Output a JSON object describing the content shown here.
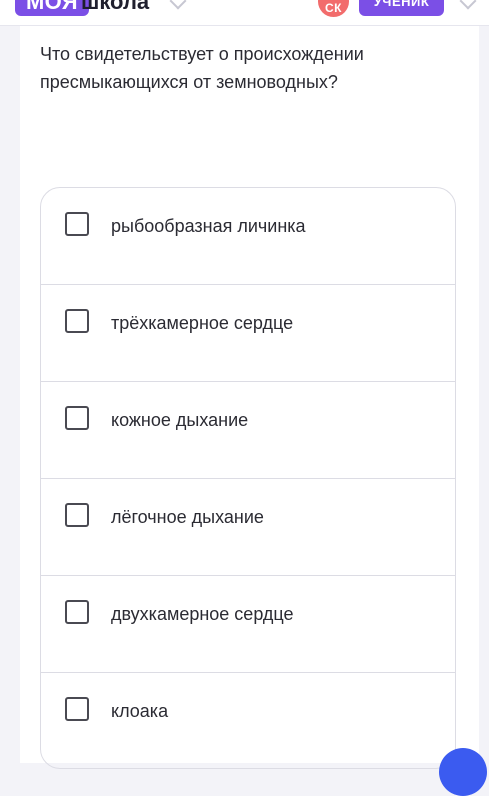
{
  "header": {
    "logo_badge": "МОЯ",
    "logo_text": "школа",
    "avatar_initials": "СК",
    "role_label": "УЧЕНИК"
  },
  "quiz": {
    "question": "Что свидетельствует о происхождении пресмыкающихся от земноводных?",
    "options": [
      {
        "label": "рыбообразная личинка",
        "checked": false
      },
      {
        "label": "трёхкамерное сердце",
        "checked": false
      },
      {
        "label": "кожное дыхание",
        "checked": false
      },
      {
        "label": "лёгочное дыхание",
        "checked": false
      },
      {
        "label": "двухкамерное сердце",
        "checked": false
      },
      {
        "label": "клоака",
        "checked": false
      }
    ]
  },
  "colors": {
    "brand": "#7b4fe6",
    "avatar": "#f26c6c",
    "fab": "#3b5bf0",
    "page_bg": "#f3f3f8"
  }
}
